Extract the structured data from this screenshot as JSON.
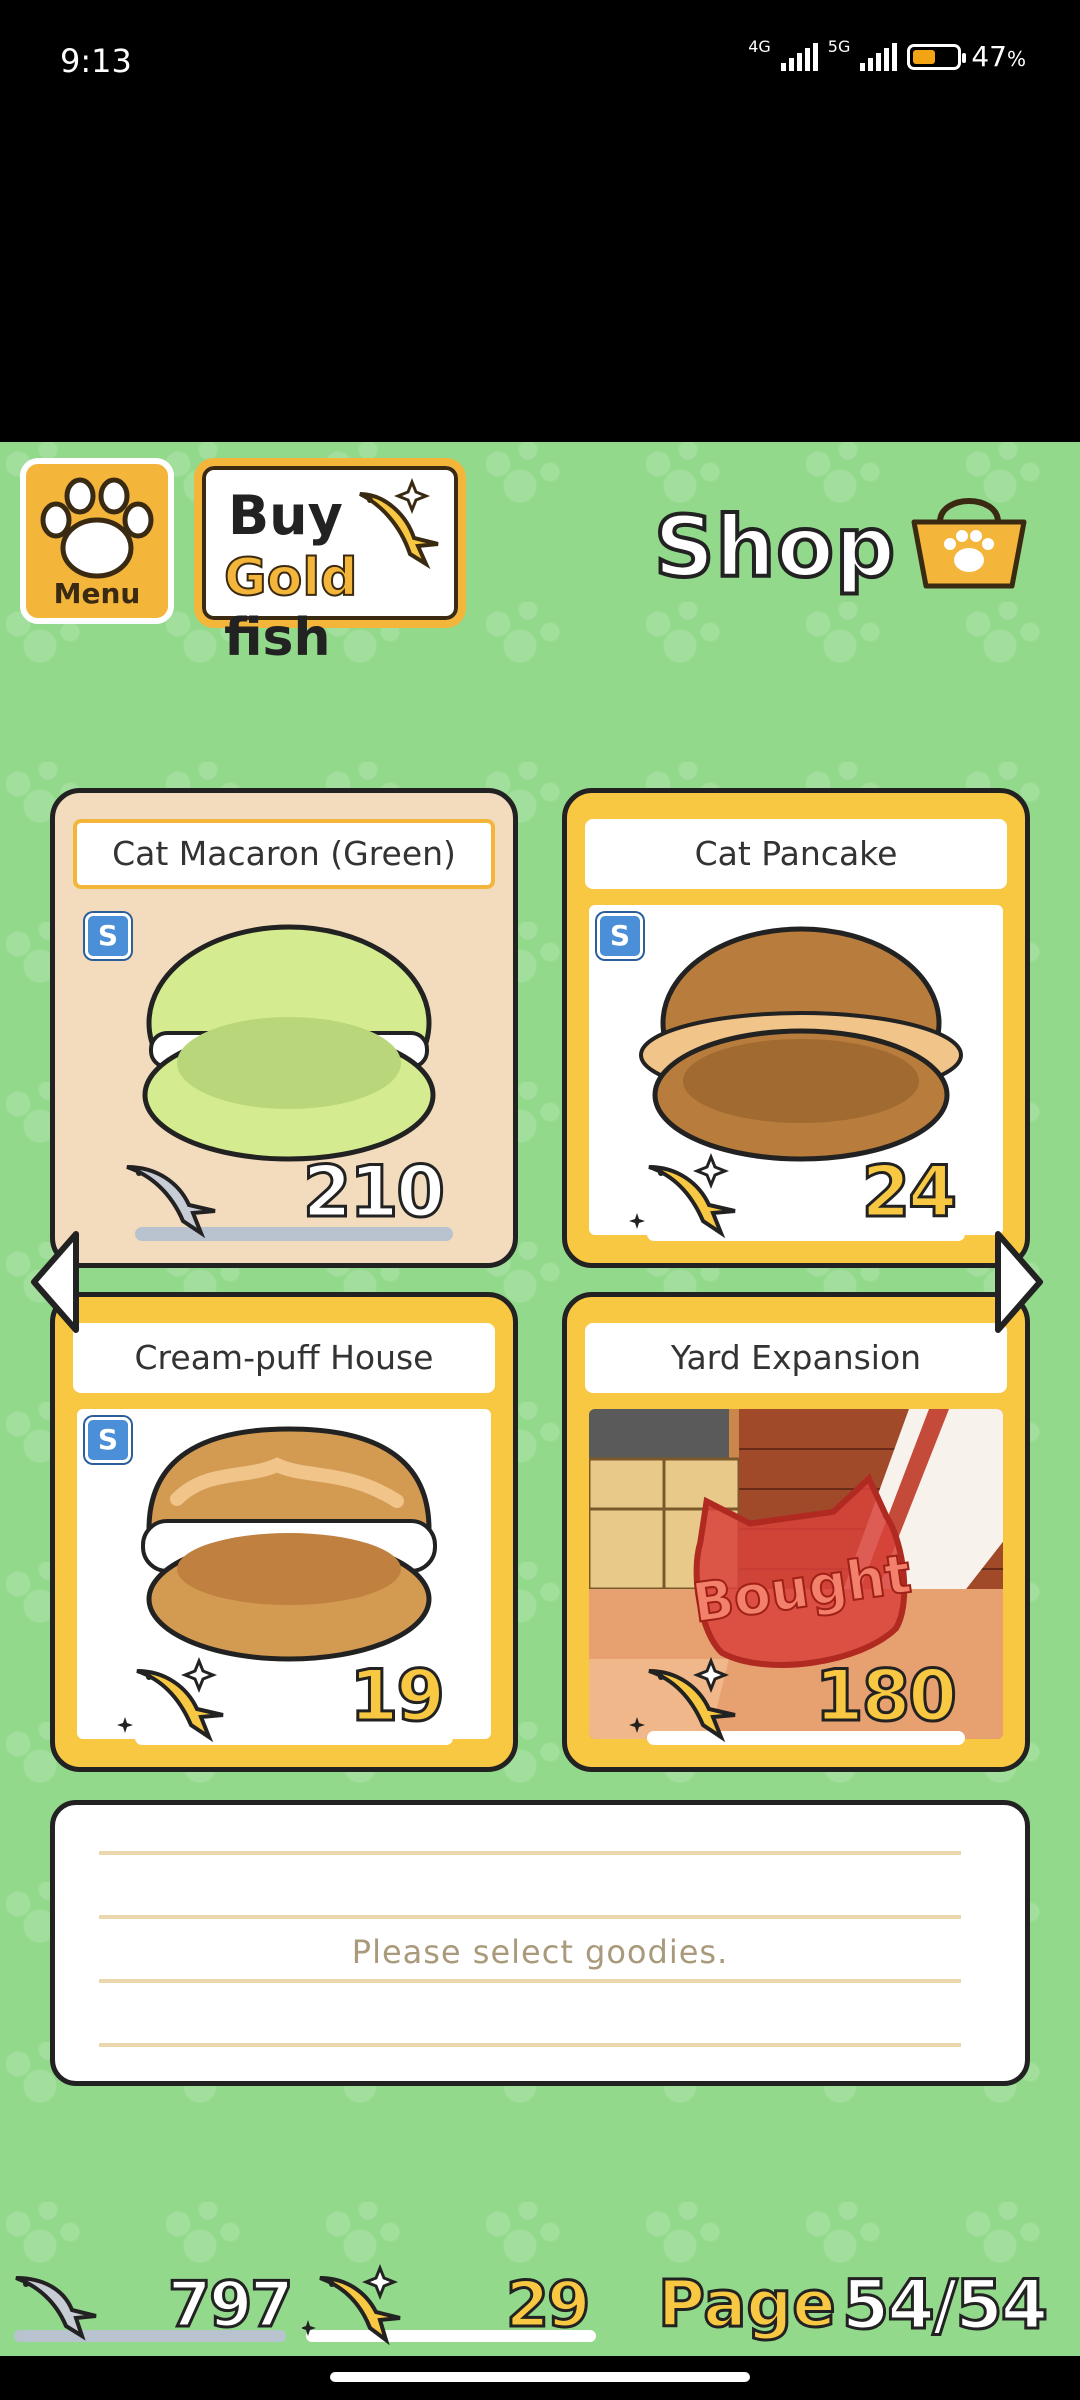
{
  "status_bar": {
    "time": "9:13",
    "network_1": "4G",
    "network_2": "5G",
    "battery": "47",
    "battery_unit": "%"
  },
  "header": {
    "menu_label": "Menu",
    "buy_line1": "Buy",
    "buy_gold": "Gold",
    "buy_fish": "fish",
    "shop_title": "Shop"
  },
  "items": [
    {
      "title": "Cat Macaron (Green)",
      "badge": "S",
      "price": "210",
      "currency": "silver-fish",
      "selected": true
    },
    {
      "title": "Cat Pancake",
      "badge": "S",
      "price": "24",
      "currency": "gold-fish"
    },
    {
      "title": "Cream-puff House",
      "badge": "S",
      "price": "19",
      "currency": "gold-fish"
    },
    {
      "title": "Yard Expansion",
      "price": "180",
      "currency": "gold-fish",
      "stamp": "Bought"
    }
  ],
  "description": {
    "text": "Please select goodies."
  },
  "footer": {
    "silver_fish": "797",
    "gold_fish": "29",
    "page_label": "Page",
    "page_number": "54/54"
  },
  "colors": {
    "background_green": "#93d98c",
    "accent_gold": "#f3b53a",
    "selected_card": "#f3dcbd",
    "badge_blue": "#4a8fd8",
    "bought_red": "#d8423a"
  },
  "icons": [
    "paw-icon",
    "gold-fish-icon",
    "shop-bag-icon",
    "silver-fish-icon",
    "arrow-left-icon",
    "arrow-right-icon",
    "sparkle-icon"
  ]
}
